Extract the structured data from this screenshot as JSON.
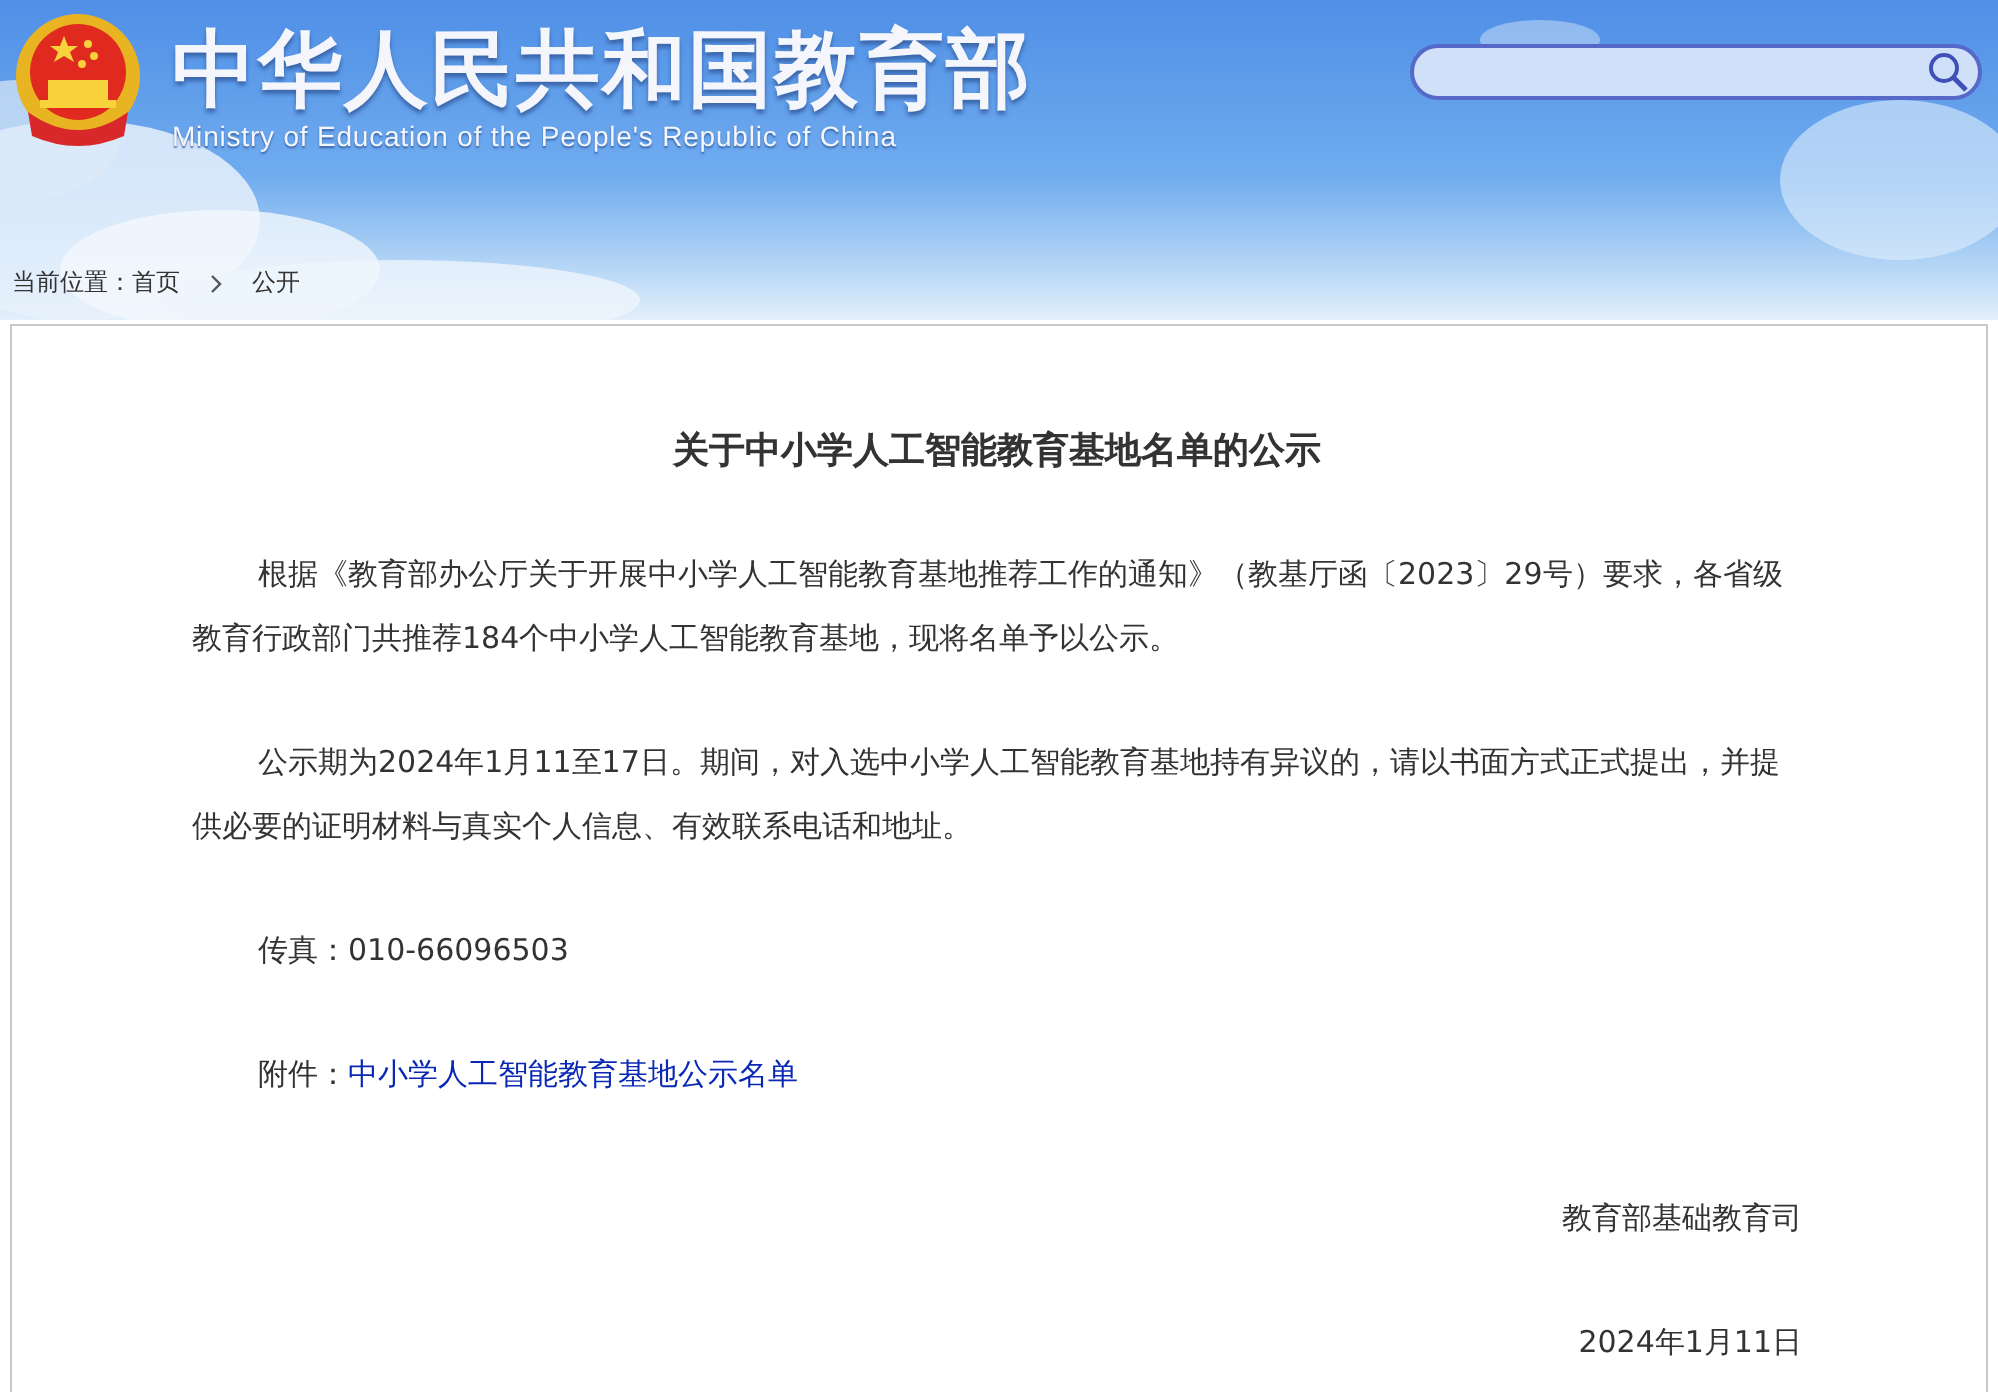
{
  "header": {
    "title": "中华人民共和国教育部",
    "subtitle": "Ministry of Education of the People's Republic of China"
  },
  "breadcrumb": {
    "label": "当前位置：",
    "items": [
      "首页",
      "公开"
    ]
  },
  "article": {
    "title": "关于中小学人工智能教育基地名单的公示",
    "paragraphs": [
      {
        "kind": "text",
        "text": "根据《教育部办公厅关于开展中小学人工智能教育基地推荐工作的通知》（教基厅函〔2023〕29号）要求，各省级教育行政部门共推荐184个中小学人工智能教育基地，现将名单予以公示。"
      },
      {
        "kind": "text",
        "text": "公示期为2024年1月11至17日。期间，对入选中小学人工智能教育基地持有异议的，请以书面方式正式提出，并提供必要的证明材料与真实个人信息、有效联系电话和地址。"
      },
      {
        "kind": "text",
        "text": "传真：010-66096503"
      },
      {
        "kind": "link",
        "label": "附件：",
        "link": "中小学人工智能教育基地公示名单"
      }
    ],
    "signature": "教育部基础教育司",
    "date": "2024年1月11日"
  }
}
